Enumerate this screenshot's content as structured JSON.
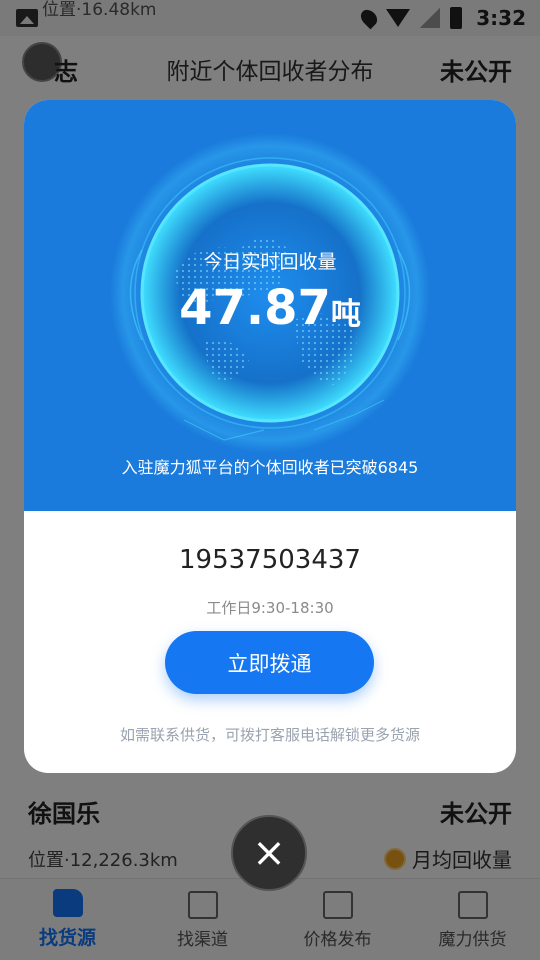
{
  "status_bar": {
    "time": "3:32",
    "behind_text": "位置·16.48km"
  },
  "background": {
    "header": {
      "name_fragment": "志",
      "title": "附近个体回收者分布",
      "status": "未公开"
    },
    "card": {
      "name": "徐国乐",
      "status": "未公开",
      "location": "位置·12,226.3km",
      "monthly_label": "月均回收量"
    },
    "tabs": [
      {
        "label": "找货源",
        "icon": "truck-icon",
        "active": true
      },
      {
        "label": "找渠道",
        "icon": "factory-icon",
        "active": false
      },
      {
        "label": "价格发布",
        "icon": "price-document-icon",
        "active": false
      },
      {
        "label": "魔力供货",
        "icon": "list-document-icon",
        "active": false
      }
    ]
  },
  "modal": {
    "realtime_label": "今日实时回收量",
    "realtime_value": "47.87",
    "realtime_unit": "吨",
    "collectors_caption": "入驻魔力狐平台的个体回收者已突破6845",
    "phone": "19537503437",
    "hours": "工作日9:30-18:30",
    "call_button": "立即拨通",
    "footnote": "如需联系供货，可拨打客服电话解锁更多货源"
  },
  "colors": {
    "accent": "#1677f2",
    "hero_bg": "#1a7bdc",
    "overlay": "rgba(0,0,0,0.5)"
  }
}
